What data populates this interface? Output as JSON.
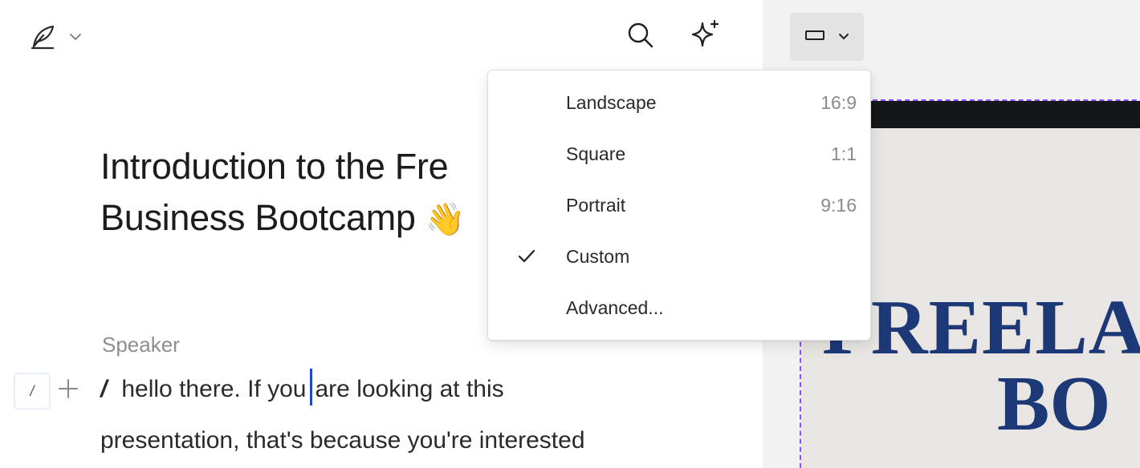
{
  "editor": {
    "title_line1": "Introduction to the Fre",
    "title_line2": "Business Bootcamp",
    "title_emoji": "👋",
    "speaker_label": "Speaker",
    "slash_handle": "/",
    "slash_char": "/",
    "body_line1_before_caret": "hello there. If you",
    "body_line1_after_caret": "are looking at this",
    "body_line2": "presentation, that's because you're interested"
  },
  "toolbar": {
    "brand_icon": "quill-icon",
    "search_icon": "search-icon",
    "ai_icon": "sparkle-icon"
  },
  "aspect_menu": {
    "items": [
      {
        "label": "Landscape",
        "ratio": "16:9",
        "checked": false
      },
      {
        "label": "Square",
        "ratio": "1:1",
        "checked": false
      },
      {
        "label": "Portrait",
        "ratio": "9:16",
        "checked": false
      },
      {
        "label": "Custom",
        "ratio": "",
        "checked": true
      },
      {
        "label": "Advanced...",
        "ratio": "",
        "checked": false
      }
    ]
  },
  "preview": {
    "slide_headline": "FREELA",
    "slide_subline": "BO"
  },
  "colors": {
    "caret": "#2346c8",
    "slide_text": "#1d3877",
    "frame_dash": "#8a4dff",
    "slide_bg": "#e9e5e2"
  }
}
